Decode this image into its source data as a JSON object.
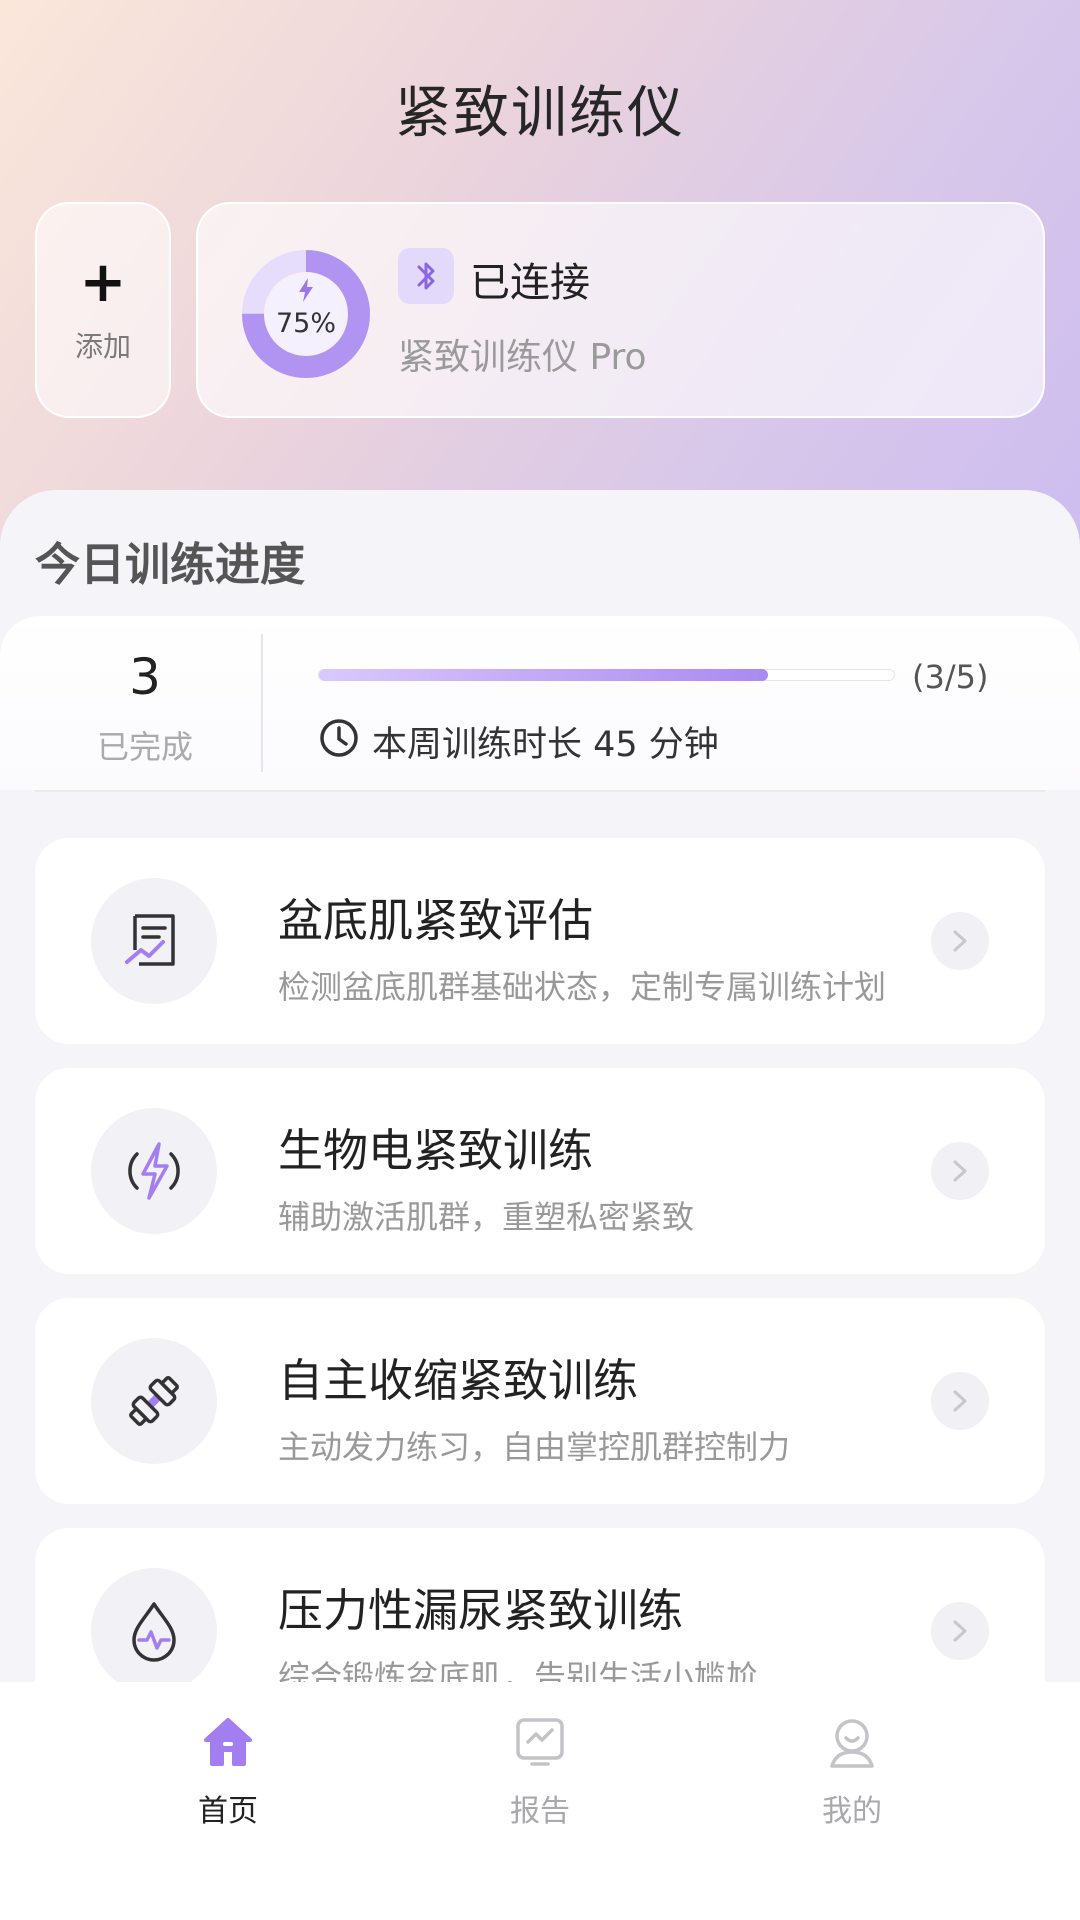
{
  "header": {
    "title": "紧致训练仪"
  },
  "add_card": {
    "icon": "plus-icon",
    "label": "添加"
  },
  "device": {
    "battery_percent_label": "75%",
    "battery_level": 0.75,
    "bluetooth_icon": "bluetooth-icon",
    "status": "已连接",
    "name": "紧致训练仪 Pro"
  },
  "progress": {
    "section_title": "今日训练进度",
    "completed_count": "3",
    "completed_label": "已完成",
    "ratio_text": "(3/5)",
    "progress_fraction": 0.78,
    "weekly_text": "本周训练时长 45 分钟"
  },
  "items": [
    {
      "icon": "assessment-chart-icon",
      "title": "盆底肌紧致评估",
      "subtitle": "检测盆底肌群基础状态，定制专属训练计划"
    },
    {
      "icon": "lightning-bolt-icon",
      "title": "生物电紧致训练",
      "subtitle": "辅助激活肌群，重塑私密紧致"
    },
    {
      "icon": "dumbbell-icon",
      "title": "自主收缩紧致训练",
      "subtitle": "主动发力练习，自由掌控肌群控制力"
    },
    {
      "icon": "water-drop-pulse-icon",
      "title": "压力性漏尿紧致训练",
      "subtitle": "综合锻炼盆底肌，告别生活小尴尬"
    }
  ],
  "tabbar": {
    "tabs": [
      {
        "label": "首页",
        "icon": "home-icon",
        "active": true
      },
      {
        "label": "报告",
        "icon": "report-icon",
        "active": false
      },
      {
        "label": "我的",
        "icon": "profile-icon",
        "active": false
      }
    ]
  },
  "colors": {
    "accent": "#a27ef0",
    "accent_light": "#e3d9fb",
    "sheet_bg": "#f5f4f8"
  }
}
